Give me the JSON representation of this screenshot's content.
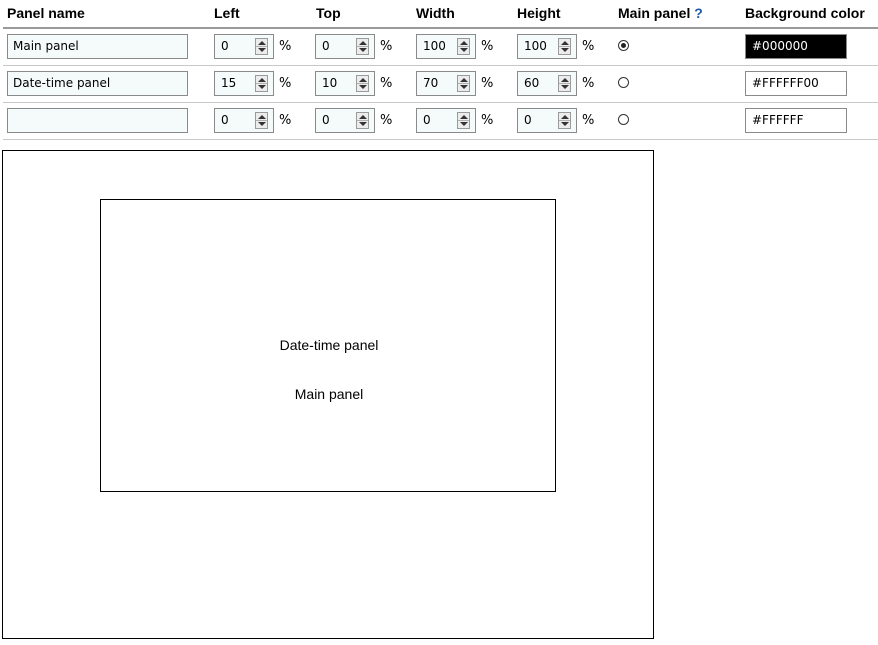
{
  "headers": {
    "panel_name": "Panel name",
    "left": "Left",
    "top": "Top",
    "width": "Width",
    "height": "Height",
    "main_panel": "Main panel",
    "help": "?",
    "background_color": "Background color"
  },
  "unit": "%",
  "rows": [
    {
      "name": "Main panel",
      "left": "0",
      "top": "0",
      "width": "100",
      "height": "100",
      "main": true,
      "color": "#000000"
    },
    {
      "name": "Date-time panel",
      "left": "15",
      "top": "10",
      "width": "70",
      "height": "60",
      "main": false,
      "color": "#FFFFFF00"
    },
    {
      "name": "",
      "left": "0",
      "top": "0",
      "width": "0",
      "height": "0",
      "main": false,
      "color": "#FFFFFF"
    }
  ],
  "preview": {
    "labels": [
      "Date-time panel",
      "Main panel"
    ]
  },
  "colors": {
    "main_swatch_bg": "#000000",
    "main_swatch_text": "#ffffff",
    "help_color": "#1f5aa6"
  }
}
